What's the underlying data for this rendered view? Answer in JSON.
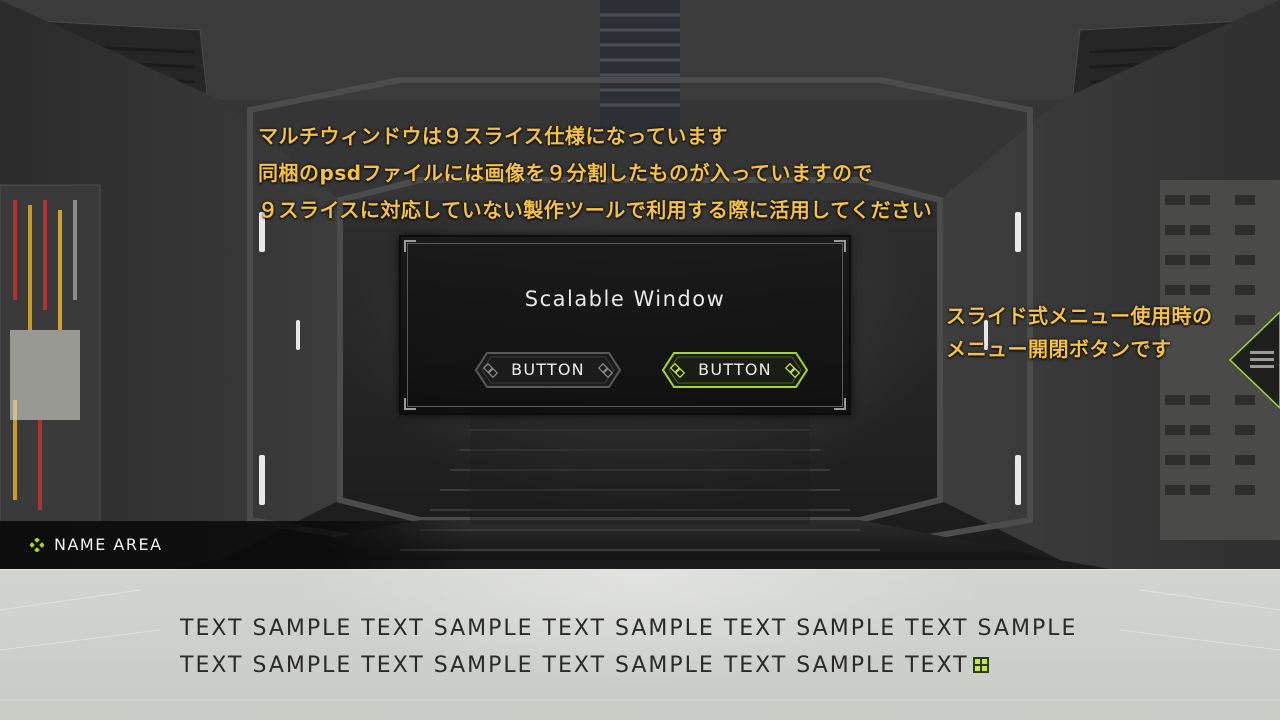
{
  "annotations": {
    "main_lines": [
      "マルチウィンドウは９スライス仕様になっています",
      "同梱のpsdファイルには画像を９分割したものが入っていますので",
      "９スライスに対応していない製作ツールで利用する際に活用してください"
    ],
    "menu_lines": [
      "スライド式メニュー使用時の",
      "メニュー開閉ボタンです"
    ],
    "color": "#f5c242"
  },
  "window": {
    "title": "Scalable Window",
    "buttons": [
      {
        "label": "BUTTON",
        "state": "normal"
      },
      {
        "label": "BUTTON",
        "state": "selected"
      }
    ]
  },
  "menu_toggle": {
    "icon": "hamburger-icon",
    "accent": "#a7d62a"
  },
  "name_area": {
    "icon": "diamond-cluster-icon",
    "label": "NAME AREA",
    "accent": "#a7d62a"
  },
  "message_box": {
    "lines": [
      "TEXT SAMPLE TEXT SAMPLE TEXT SAMPLE TEXT SAMPLE TEXT SAMPLE",
      "TEXT SAMPLE TEXT SAMPLE TEXT SAMPLE TEXT SAMPLE TEXT"
    ],
    "next_icon": "next-page-icon",
    "accent": "#c8e64a"
  }
}
